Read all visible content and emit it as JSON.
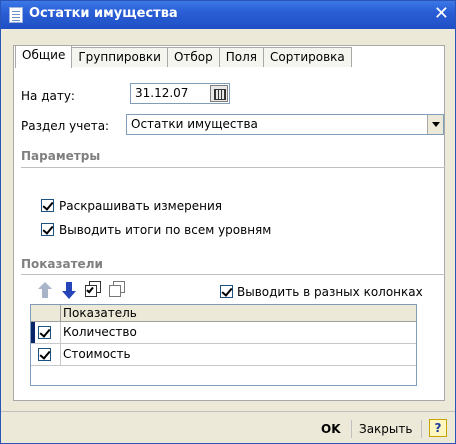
{
  "window": {
    "title": "Остатки имущества"
  },
  "tabs": [
    {
      "label": "Общие"
    },
    {
      "label": "Группировки"
    },
    {
      "label": "Отбор"
    },
    {
      "label": "Поля"
    },
    {
      "label": "Сортировка"
    }
  ],
  "form": {
    "date_label": "На дату:",
    "date_value": "31.12.07",
    "section_label": "Раздел учета:",
    "section_value": "Остатки имущества"
  },
  "params": {
    "title": "Параметры",
    "opt1": "Раскрашивать измерения",
    "opt2": "Выводить итоги по всем уровням"
  },
  "indicators": {
    "title": "Показатели",
    "columns_option": "Выводить в разных колонках",
    "header": "Показатель",
    "rows": [
      "Количество",
      "Стоимость"
    ]
  },
  "buttons": {
    "ok": "OK",
    "close": "Закрыть",
    "help": "?"
  }
}
